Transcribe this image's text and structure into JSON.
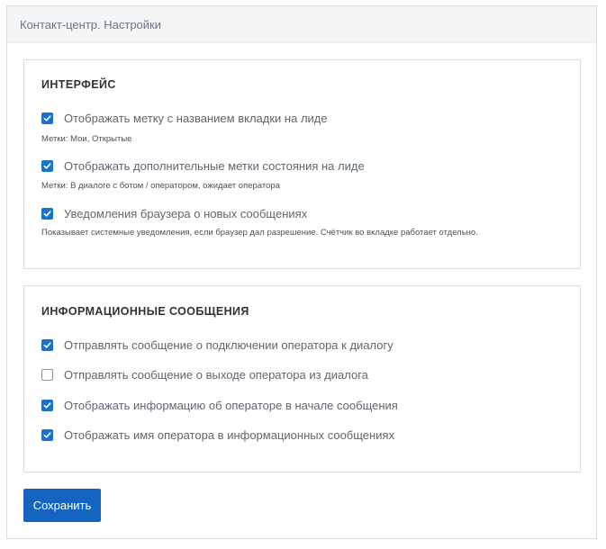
{
  "header": {
    "title": "Контакт-центр. Настройки"
  },
  "interface": {
    "title": "ИНТЕРФЕЙС",
    "options": [
      {
        "label": "Отображать метку с названием вкладки на лиде",
        "checked": true,
        "hint": "Метки: Мои, Открытые"
      },
      {
        "label": "Отображать дополнительные метки состояния на лиде",
        "checked": true,
        "hint": "Метки: В диалоге с ботом / оператором, ожидает оператора"
      },
      {
        "label": "Уведомления браузера о новых сообщениях",
        "checked": true,
        "hint": "Показывает системные уведомления, если браузер дал разрешение. Счётчик во вкладке работает отдельно."
      }
    ]
  },
  "info_messages": {
    "title": "ИНФОРМАЦИОННЫЕ СООБЩЕНИЯ",
    "options": [
      {
        "label": "Отправлять сообщение о подключении оператора к диалогу",
        "checked": true
      },
      {
        "label": "Отправлять сообщение о выходе оператора из диалога",
        "checked": false
      },
      {
        "label": "Отображать информацию об операторе в начале сообщения",
        "checked": true
      },
      {
        "label": "Отображать имя оператора в информационных сообщениях",
        "checked": true
      }
    ]
  },
  "actions": {
    "save_label": "Сохранить"
  },
  "colors": {
    "accent": "#1a73c9",
    "button": "#1565c0"
  }
}
